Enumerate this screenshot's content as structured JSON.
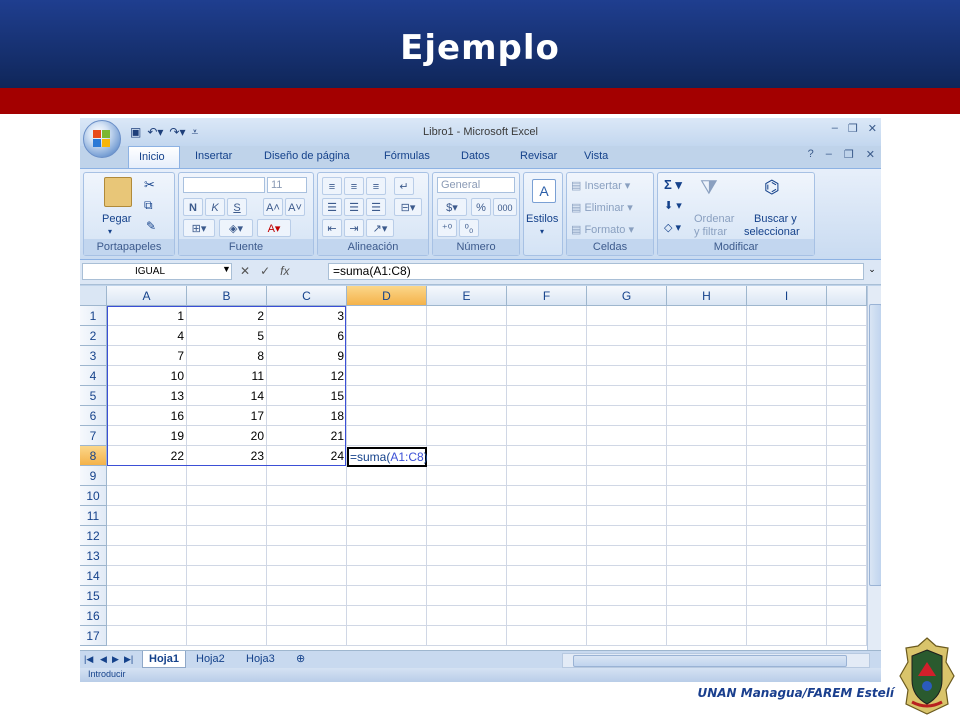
{
  "slide": {
    "title": "Ejemplo",
    "footer": "UNAN Managua/FAREM Estelí",
    "colors": {
      "header_blue": "#1b3a85",
      "band_red": "#a30000",
      "footer_blue": "#1a3f8e"
    }
  },
  "excel": {
    "window_title": "Libro1 - Microsoft Excel",
    "tabs": [
      "Inicio",
      "Insertar",
      "Diseño de página",
      "Fórmulas",
      "Datos",
      "Revisar",
      "Vista"
    ],
    "active_tab": "Inicio",
    "ribbon": {
      "portapapeles": {
        "label": "Portapapeles",
        "paste_label": "Pegar"
      },
      "fuente": {
        "label": "Fuente",
        "font_size": "11",
        "bold": "N",
        "italic": "K",
        "underline": "S"
      },
      "alineacion": {
        "label": "Alineación"
      },
      "numero": {
        "label": "Número",
        "format": "General",
        "percent": "%",
        "thousands": "000"
      },
      "estilos": {
        "label": "Estilos"
      },
      "celdas": {
        "label": "Celdas",
        "insert": "Insertar",
        "delete": "Eliminar",
        "format": "Formato"
      },
      "modificar": {
        "label": "Modificar",
        "sort_1": "Ordenar",
        "sort_2": "y filtrar",
        "find_1": "Buscar y",
        "find_2": "seleccionar",
        "sigma": "Σ"
      }
    },
    "formula_bar": {
      "name_box": "IGUAL",
      "fx": "fx",
      "formula": "=suma(A1:C8)"
    },
    "columns": [
      "A",
      "B",
      "C",
      "D",
      "E",
      "F",
      "G",
      "H",
      "I"
    ],
    "selected_column": "D",
    "rows": [
      "1",
      "2",
      "3",
      "4",
      "5",
      "6",
      "7",
      "8",
      "9",
      "10",
      "11",
      "12",
      "13",
      "14",
      "15",
      "16",
      "17"
    ],
    "selected_row": "8",
    "cells": [
      [
        "1",
        "2",
        "3"
      ],
      [
        "4",
        "5",
        "6"
      ],
      [
        "7",
        "8",
        "9"
      ],
      [
        "10",
        "11",
        "12"
      ],
      [
        "13",
        "14",
        "15"
      ],
      [
        "16",
        "17",
        "18"
      ],
      [
        "19",
        "20",
        "21"
      ],
      [
        "22",
        "23",
        "24"
      ]
    ],
    "active_cell": {
      "prefix": "=suma(",
      "ref": "A1:C8",
      "suffix": ")"
    },
    "sheet_tabs": [
      "Hoja1",
      "Hoja2",
      "Hoja3"
    ],
    "active_sheet": "Hoja1",
    "status": "Introducir"
  }
}
